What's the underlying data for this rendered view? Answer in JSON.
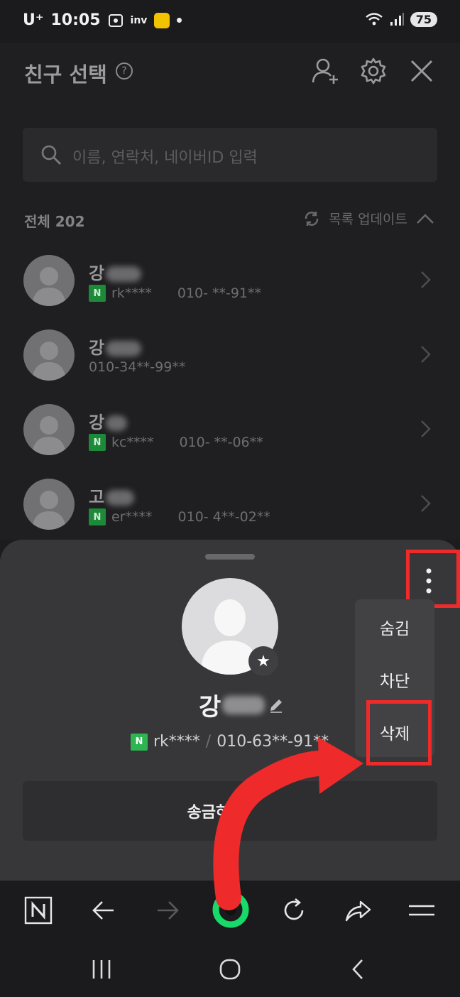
{
  "status": {
    "carrier": "U⁺",
    "time": "10:05",
    "app_label": "inv",
    "battery": "75"
  },
  "header": {
    "title": "친구 선택",
    "help": "?"
  },
  "search": {
    "placeholder": "이름, 연락처, 네이버ID 입력"
  },
  "list": {
    "total_label": "전체 202",
    "refresh_label": "목록 업데이트"
  },
  "friends": [
    {
      "name_prefix": "강",
      "id": "rk****",
      "phone": "010-  **-91**",
      "naver": true
    },
    {
      "name_prefix": "강",
      "id": "",
      "phone": "010-34**-99**",
      "naver": false
    },
    {
      "name_prefix": "강",
      "id": "kc****",
      "phone": "010-  **-06**",
      "naver": true
    },
    {
      "name_prefix": "고",
      "id": "er****",
      "phone": "010-  4**-02**",
      "naver": true
    }
  ],
  "naver_badge": "N",
  "profile": {
    "name_prefix": "강",
    "id": "rk****",
    "separator": "/",
    "phone": "010-63**-91**",
    "star": "★"
  },
  "send_button": "송금하기",
  "menu": {
    "hide": "숨김",
    "block": "차단",
    "delete": "삭제"
  },
  "colors": {
    "annotation": "#ef2a2a",
    "naver_green": "#2db552",
    "accent_green": "#19d96b"
  }
}
